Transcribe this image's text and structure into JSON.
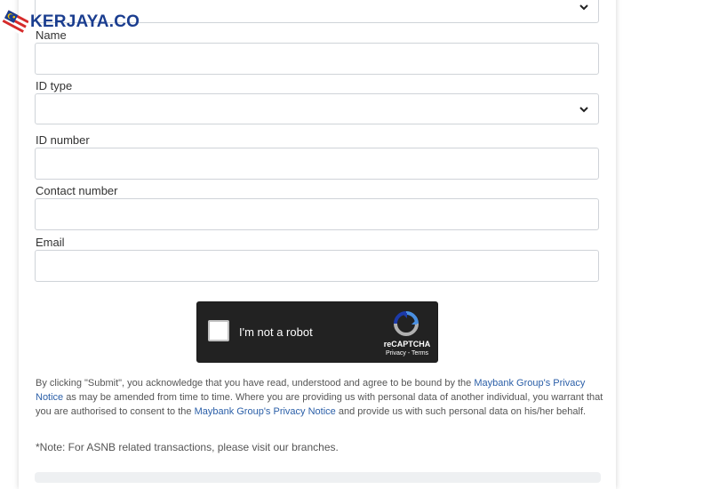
{
  "brand": {
    "logo_text": "KERJAYA.CO"
  },
  "form": {
    "name_label": "Name",
    "id_type_label": "ID type",
    "id_number_label": "ID number",
    "contact_label": "Contact number",
    "email_label": "Email"
  },
  "recaptcha": {
    "label": "I'm not a robot",
    "brand": "reCAPTCHA",
    "privacy": "Privacy",
    "separator": " - ",
    "terms": "Terms"
  },
  "notice": {
    "part1": "By clicking \"Submit\", you acknowledge that you have read, understood and agree to be bound by the ",
    "link1": "Maybank Group's Privacy Notice",
    "part2": " as may be amended from time to time. Where you are providing us with personal data of another individual, you warrant that you are authorised to consent to the ",
    "link2": "Maybank Group's Privacy Notice",
    "part3": " and provide us with such personal data on his/her behalf."
  },
  "note": "*Note: For ASNB related transactions, please visit our branches.",
  "colors": {
    "link": "#2b5fa8",
    "brand": "#1a3d8f",
    "recaptcha_bg": "#222222"
  }
}
